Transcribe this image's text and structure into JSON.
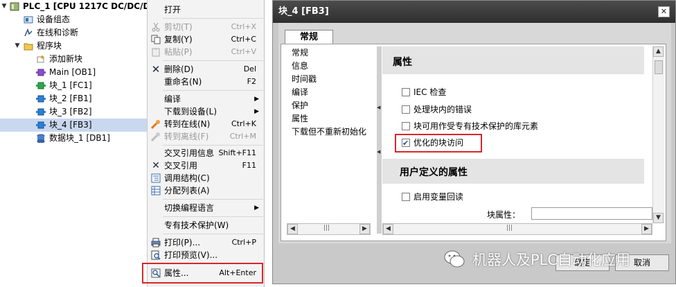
{
  "tree": {
    "plc": "PLC_1 [CPU 1217C DC/DC/DC]",
    "items": [
      "设备组态",
      "在线和诊断",
      "程序块",
      "添加新块",
      "Main [OB1]",
      "块_1 [FC1]",
      "块_2 [FB1]",
      "块_3 [FB2]",
      "块_4 [FB3]",
      "数据块_1 [DB1]"
    ]
  },
  "menu": {
    "open": "打开",
    "cut": "剪切(T)",
    "cut_sc": "Ctrl+X",
    "copy": "复制(Y)",
    "copy_sc": "Ctrl+C",
    "paste": "粘贴(P)",
    "paste_sc": "Ctrl+V",
    "delete": "删除(D)",
    "delete_sc": "Del",
    "rename": "重命名(N)",
    "rename_sc": "F2",
    "compile": "编译",
    "download": "下载到设备(L)",
    "online": "转到在线(N)",
    "online_sc": "Ctrl+K",
    "offline": "转到离线(F)",
    "offline_sc": "Ctrl+M",
    "xref_info": "交叉引用信息",
    "xref_info_sc": "Shift+F11",
    "xref": "交叉引用",
    "xref_sc": "F11",
    "callstruct": "调用结构(C)",
    "assign": "分配列表(A)",
    "switch_lang": "切换编程语言",
    "knowhow": "专有技术保护(W)",
    "print": "打印(P)...",
    "print_sc": "Ctrl+P",
    "preview": "打印预览(V)...",
    "props": "属性...",
    "props_sc": "Alt+Enter"
  },
  "dialog": {
    "title": "块_4 [FB3]",
    "close": "✕",
    "tab": "常规",
    "nav": [
      "常规",
      "信息",
      "时间戳",
      "编译",
      "保护",
      "属性",
      "下载但不重新初始化"
    ],
    "section_attributes": "属性",
    "checks": [
      {
        "label": "IEC 检查",
        "checked": false
      },
      {
        "label": "处理块内的错误",
        "checked": false
      },
      {
        "label": "块可用作受专有技术保护的库元素",
        "checked": false
      },
      {
        "label": "优化的块访问",
        "checked": true
      }
    ],
    "section_udp": "用户定义的属性",
    "readback": {
      "label": "启用变量回读",
      "checked": false
    },
    "block_attr_label": "块属性：",
    "block_attr_value": "",
    "ok": "确定",
    "cancel": "取消"
  },
  "watermark": "机器人及PLC自动化应用",
  "colors": {
    "highlight_red": "#d8262b",
    "selection": "#c9d8ee",
    "title_bar": "#3a3a3a"
  }
}
